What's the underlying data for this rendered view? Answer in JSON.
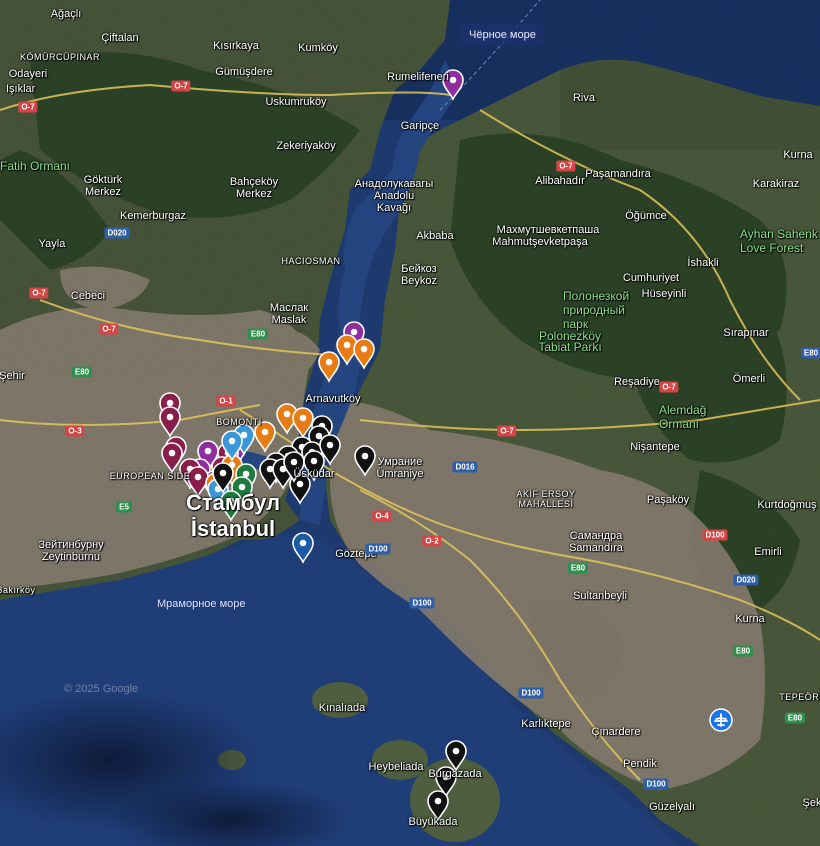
{
  "map": {
    "seas": {
      "black_sea": "Чёрное море",
      "marmara": "Мраморное море"
    },
    "city": {
      "ru": "Стамбул",
      "tr": "İstanbul"
    },
    "watermark": "© 2025 Google",
    "labels": [
      "Ağaçlı",
      "Çiftalan",
      "Kısırkaya",
      "Kumköy",
      "KÖMÜRCÜPINAR",
      "Odayeri",
      "Gümüşdere",
      "Rumelifeneri",
      "Riva",
      "Işıklar",
      "Uskumruköy",
      "Garipçe",
      "Zekeriyaköy",
      "Kurna",
      "Fatih Ormanı",
      "Göktürk",
      "Merkez",
      "Bahçeköy",
      "Merkez",
      "Анадолукавагы",
      "Anadolu",
      "Kavağı",
      "Alibahadır",
      "Paşamandıra",
      "Karakiraz",
      "Kemerburgaz",
      "Öğümce",
      "Yayla",
      "Akbaba",
      "Махмутшевкетпаша",
      "Mahmutşevketpaşa",
      "Ayhan Sahenk",
      "Love Forest",
      "HACIOSMAN",
      "İshakli",
      "Бейкоз",
      "Beykoz",
      "Cumhuriyet",
      "Cebeci",
      "Hüseyinli",
      "Полонезкой",
      "природный",
      "парк",
      "Polonezköy",
      "Tabiat Parkı",
      "Маслак",
      "Maslak",
      "Sırapınar",
      "Şehir",
      "Ömerli",
      "Reşadiye",
      "Arnavutköy",
      "BOMONTİ",
      "Alemdağ",
      "Ormanı",
      "Nişantepe",
      "Умрание",
      "Ümraniye",
      "EUROPEAN SIDE",
      "Üsküdar",
      "AKİF ERSOY",
      "MAHALLESİ",
      "Kurtdoğmuş",
      "Paşaköy",
      "Самандра",
      "Samandıra",
      "Emirli",
      "Зейтинбурну",
      "Zeytinburnu",
      "Göztepe",
      "Sultanbeyli",
      "Bakırköy",
      "Kurna",
      "TEPEÖREN",
      "Kınalıada",
      "Karlıktepe",
      "Çınardere",
      "Heybeliada",
      "Pendik",
      "Büyükada",
      "Güzelyalı",
      "Burgazada",
      "Şek"
    ],
    "roads": [
      "O-7",
      "O-7",
      "O-7",
      "D020",
      "O-7",
      "O-7",
      "E80",
      "E80",
      "O-1",
      "O-3",
      "O-7",
      "O-7",
      "E80",
      "D016",
      "O-4",
      "O-2",
      "D100",
      "D100",
      "E5",
      "D100",
      "E80",
      "D020",
      "E80",
      "D100",
      "E80",
      "D100"
    ],
    "pins": {
      "purple_count": 6,
      "maroon_count": 8,
      "orange_count": 8,
      "light_blue_count": 3,
      "green_count": 3,
      "black_count": 17,
      "blue_count": 1,
      "airport_icon": "airplane-icon"
    },
    "colors": {
      "water": "#1e3a6e",
      "land": "#5b6a4a",
      "urban": "#8f8677",
      "forest": "#2f4a2b",
      "pin_purple": "#8e2ea0",
      "pin_maroon": "#8a1e4a",
      "pin_orange": "#e77c14",
      "pin_lightblue": "#3a98d8",
      "pin_green": "#1e7a3c",
      "pin_black": "#111111",
      "pin_blue": "#1a5aa8"
    }
  }
}
